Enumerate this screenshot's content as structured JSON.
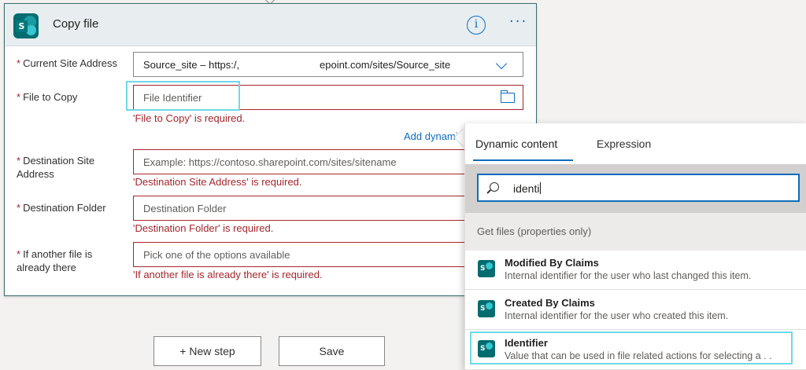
{
  "card": {
    "title": "Copy file",
    "fields": [
      {
        "label": "Current Site Address",
        "value": "Source_site – https:/, ",
        "value_tail": "epoint.com/sites/Source_site",
        "error": ""
      },
      {
        "label": "File to Copy",
        "placeholder": "File Identifier",
        "error": "'File to Copy' is required."
      },
      {
        "label_line1": "Destination Site",
        "label_line2": "Address",
        "placeholder": "Example: https://contoso.sharepoint.com/sites/sitename",
        "error": "'Destination Site Address' is required."
      },
      {
        "label": "Destination Folder",
        "placeholder": "Destination Folder",
        "error": "'Destination Folder' is required."
      },
      {
        "label_line1": "If another file is",
        "label_line2": "already there",
        "placeholder": "Pick one of the options available",
        "error": "'If another file is already there' is required."
      }
    ],
    "add_dynamic": "Add dynami"
  },
  "buttons": {
    "new_step": "+ New step",
    "save": "Save"
  },
  "panel": {
    "tabs": [
      "Dynamic content",
      "Expression"
    ],
    "search_value": "identi",
    "section": "Get files (properties only)",
    "items": [
      {
        "name": "Modified By Claims",
        "desc": "Internal identifier for the user who last changed this item."
      },
      {
        "name": "Created By Claims",
        "desc": "Internal identifier for the user who created this item."
      },
      {
        "name": "Identifier",
        "desc": "Value that can be used in file related actions for selecting a . ."
      }
    ]
  },
  "colors": {
    "accent": "#0f6cbd",
    "error": "#a4262c",
    "highlight": "#6fd8e6",
    "sharepoint": "#036c70"
  }
}
